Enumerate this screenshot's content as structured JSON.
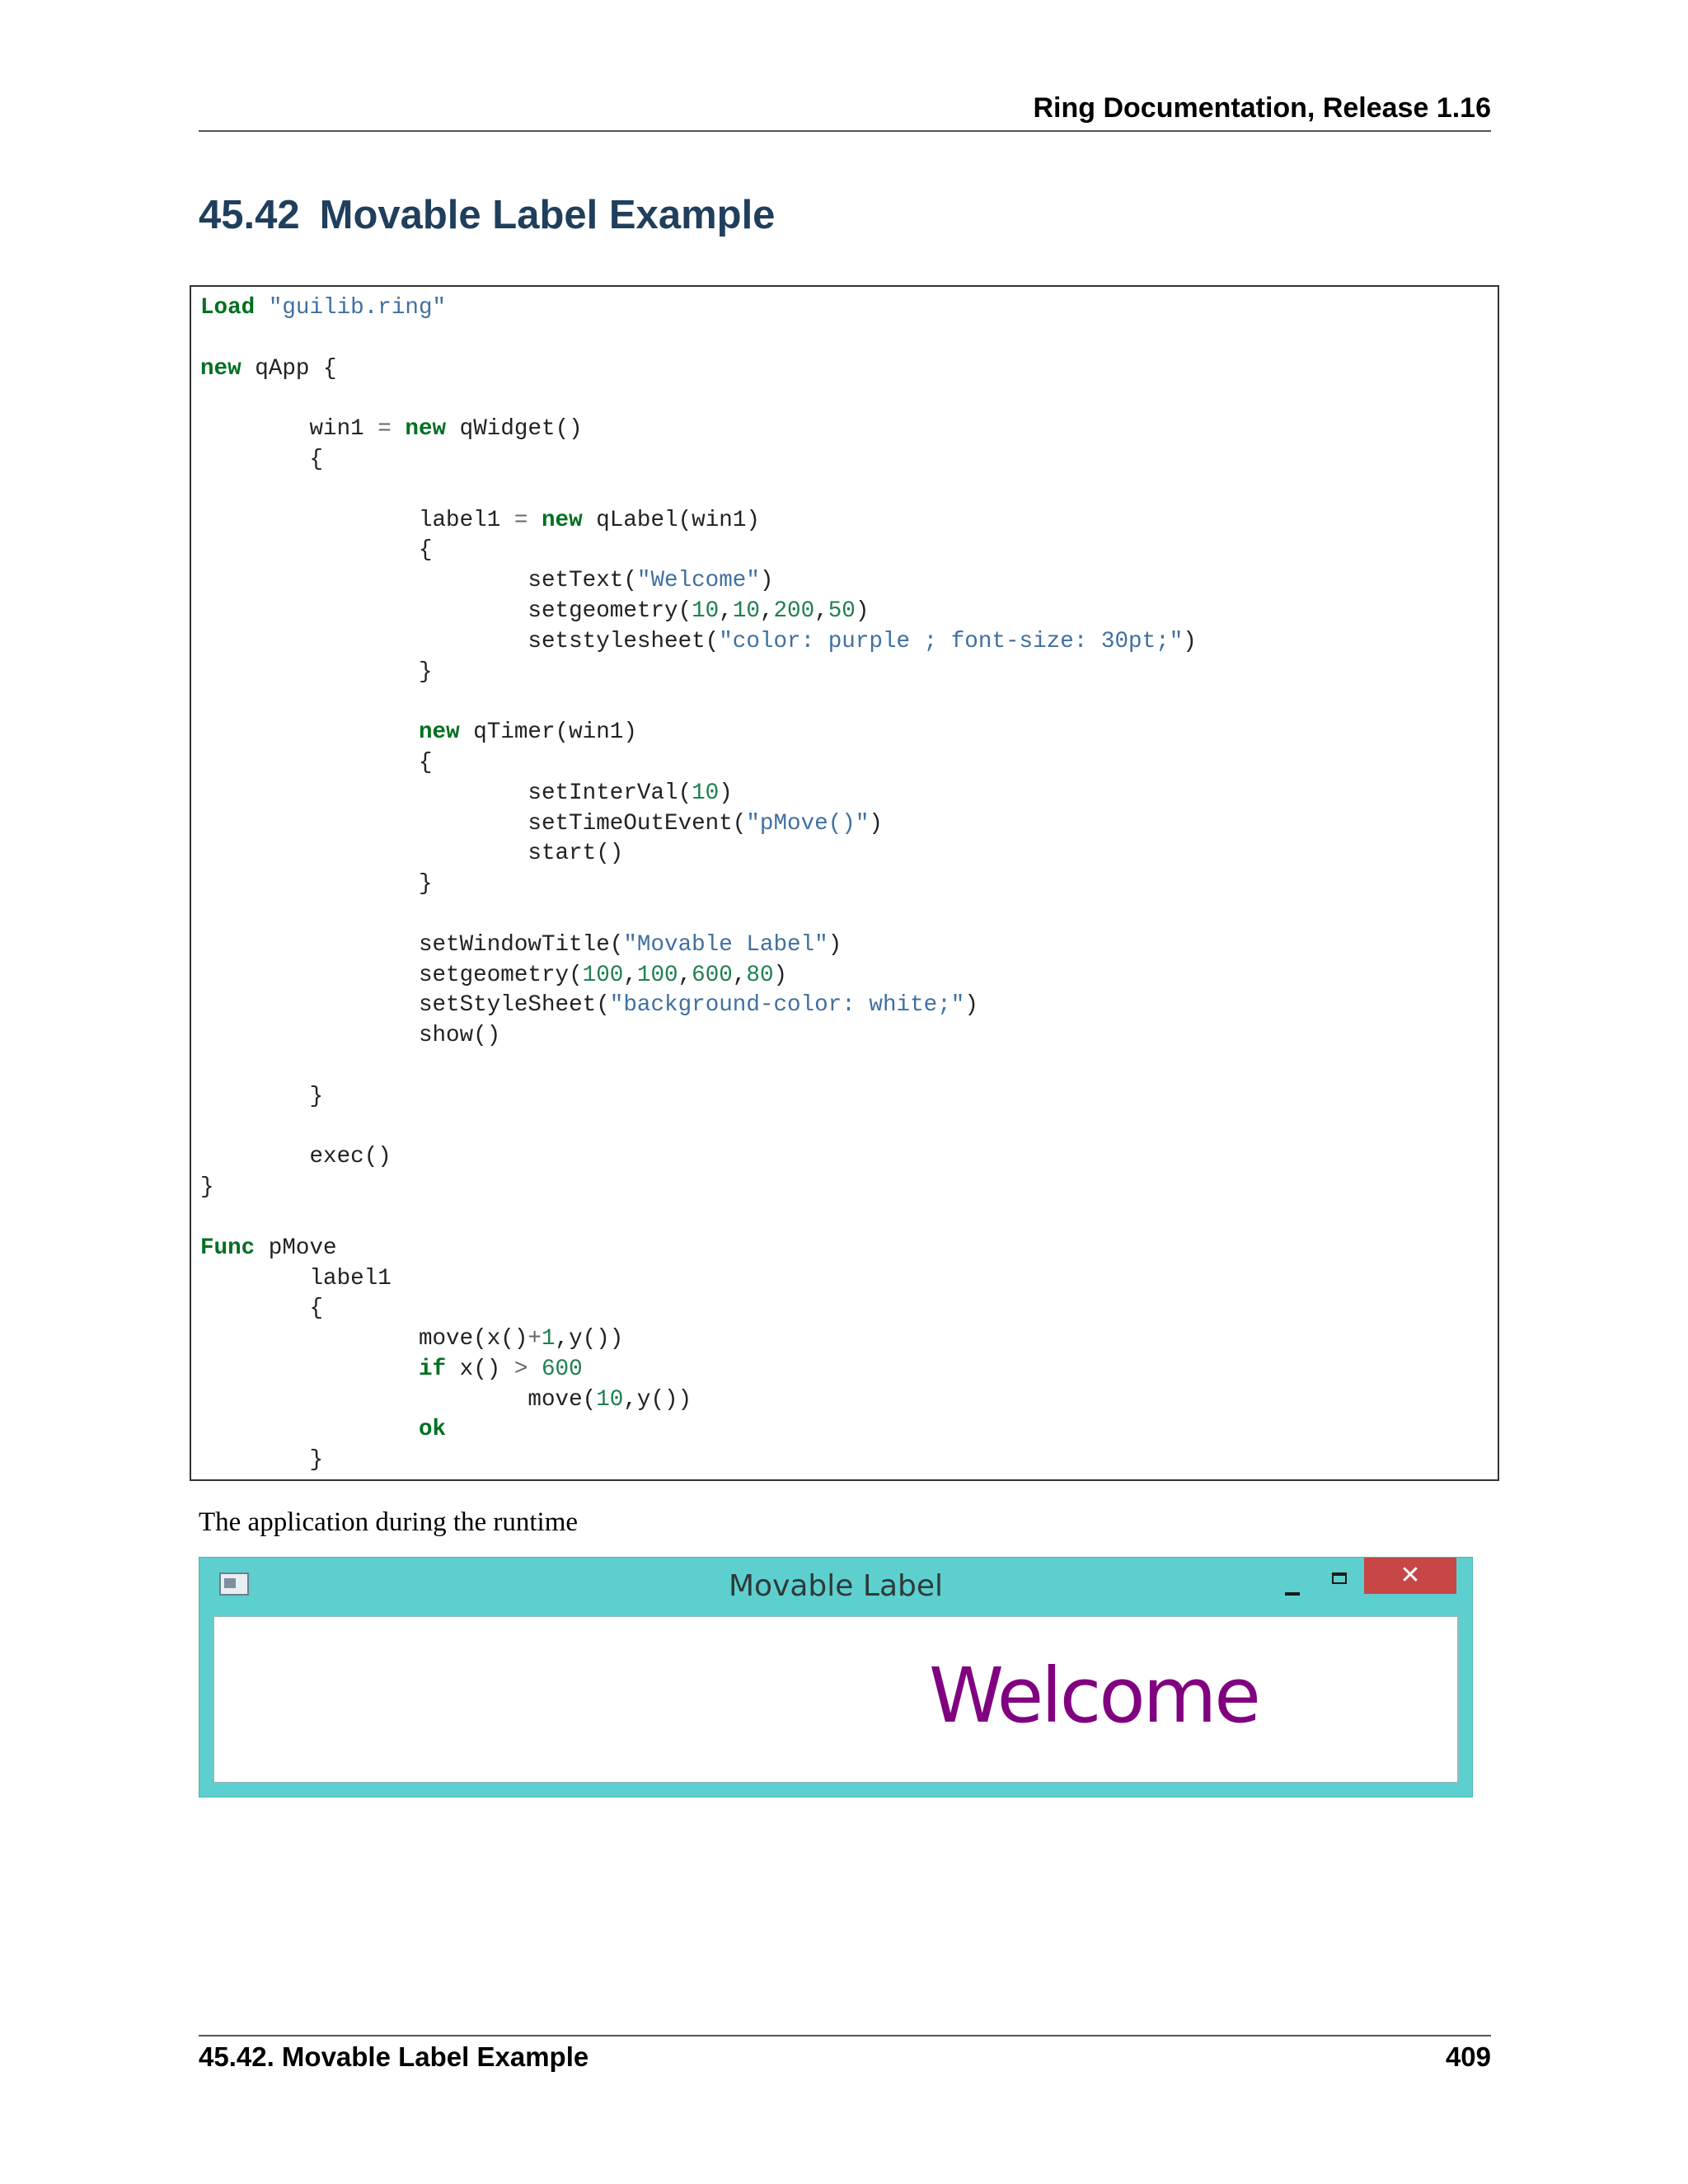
{
  "header": {
    "title": "Ring Documentation, Release 1.16"
  },
  "section": {
    "number": "45.42",
    "title": "Movable Label Example"
  },
  "code": {
    "lines": [
      "Load \"guilib.ring\"",
      "",
      "new qApp {",
      "",
      "        win1 = new qWidget()",
      "        {",
      "",
      "                label1 = new qLabel(win1)",
      "                {",
      "                        setText(\"Welcome\")",
      "                        setgeometry(10,10,200,50)",
      "                        setstylesheet(\"color: purple ; font-size: 30pt;\")",
      "                }",
      "",
      "                new qTimer(win1)",
      "                {",
      "                        setInterVal(10)",
      "                        setTimeOutEvent(\"pMove()\")",
      "                        start()",
      "                }",
      "",
      "                setWindowTitle(\"Movable Label\")",
      "                setgeometry(100,100,600,80)",
      "                setStyleSheet(\"background-color: white;\")",
      "                show()",
      "",
      "        }",
      "",
      "        exec()",
      "}",
      "",
      "Func pMove",
      "        label1",
      "        {",
      "                move(x()+1,y())",
      "                if x() > 600",
      "                        move(10,y())",
      "                ok",
      "        }"
    ]
  },
  "caption": "The application during the runtime",
  "app_window": {
    "title": "Movable Label",
    "label_text": "Welcome",
    "close_glyph": "✕",
    "icons": [
      "app-window-icon",
      "minimize-icon",
      "maximize-icon",
      "close-icon"
    ],
    "colors": {
      "frame": "#5ecfcf",
      "close": "#c74646",
      "label": "#800080"
    }
  },
  "footer": {
    "section": "45.42.  Movable Label Example",
    "page": "409"
  }
}
